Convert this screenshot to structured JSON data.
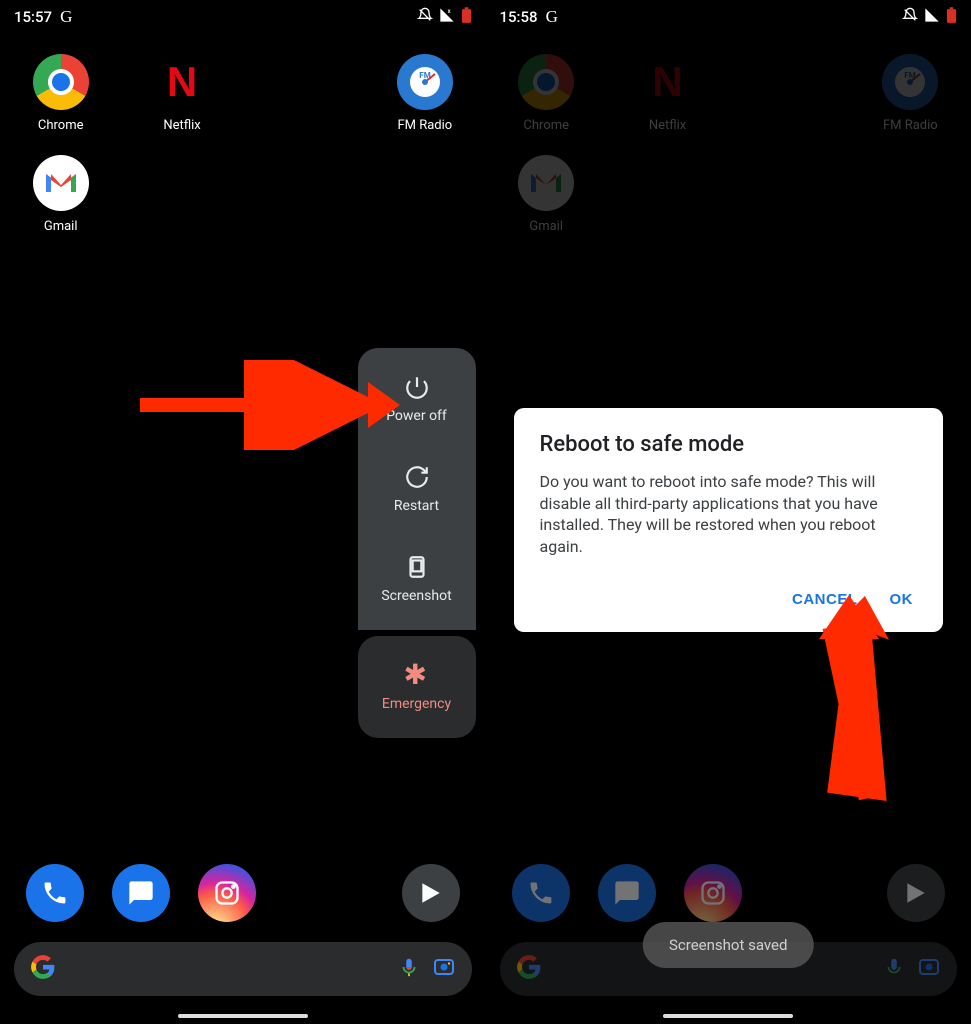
{
  "left": {
    "status": {
      "time": "15:57",
      "g": "G"
    },
    "apps": [
      {
        "label": "Chrome"
      },
      {
        "label": "Netflix"
      },
      {
        "label": ""
      },
      {
        "label": "FM Radio"
      },
      {
        "label": "Gmail"
      }
    ],
    "power_menu": {
      "poweroff": "Power off",
      "restart": "Restart",
      "screenshot": "Screenshot",
      "emergency": "Emergency"
    }
  },
  "right": {
    "status": {
      "time": "15:58",
      "g": "G"
    },
    "apps": [
      {
        "label": "Chrome"
      },
      {
        "label": "Netflix"
      },
      {
        "label": ""
      },
      {
        "label": "FM Radio"
      },
      {
        "label": "Gmail"
      }
    ],
    "dialog": {
      "title": "Reboot to safe mode",
      "body": "Do you want to reboot into safe mode? This will disable all third-party applications that you have installed. They will be restored when you reboot again.",
      "cancel": "CANCEL",
      "ok": "OK"
    },
    "toast": "Screenshot saved"
  }
}
